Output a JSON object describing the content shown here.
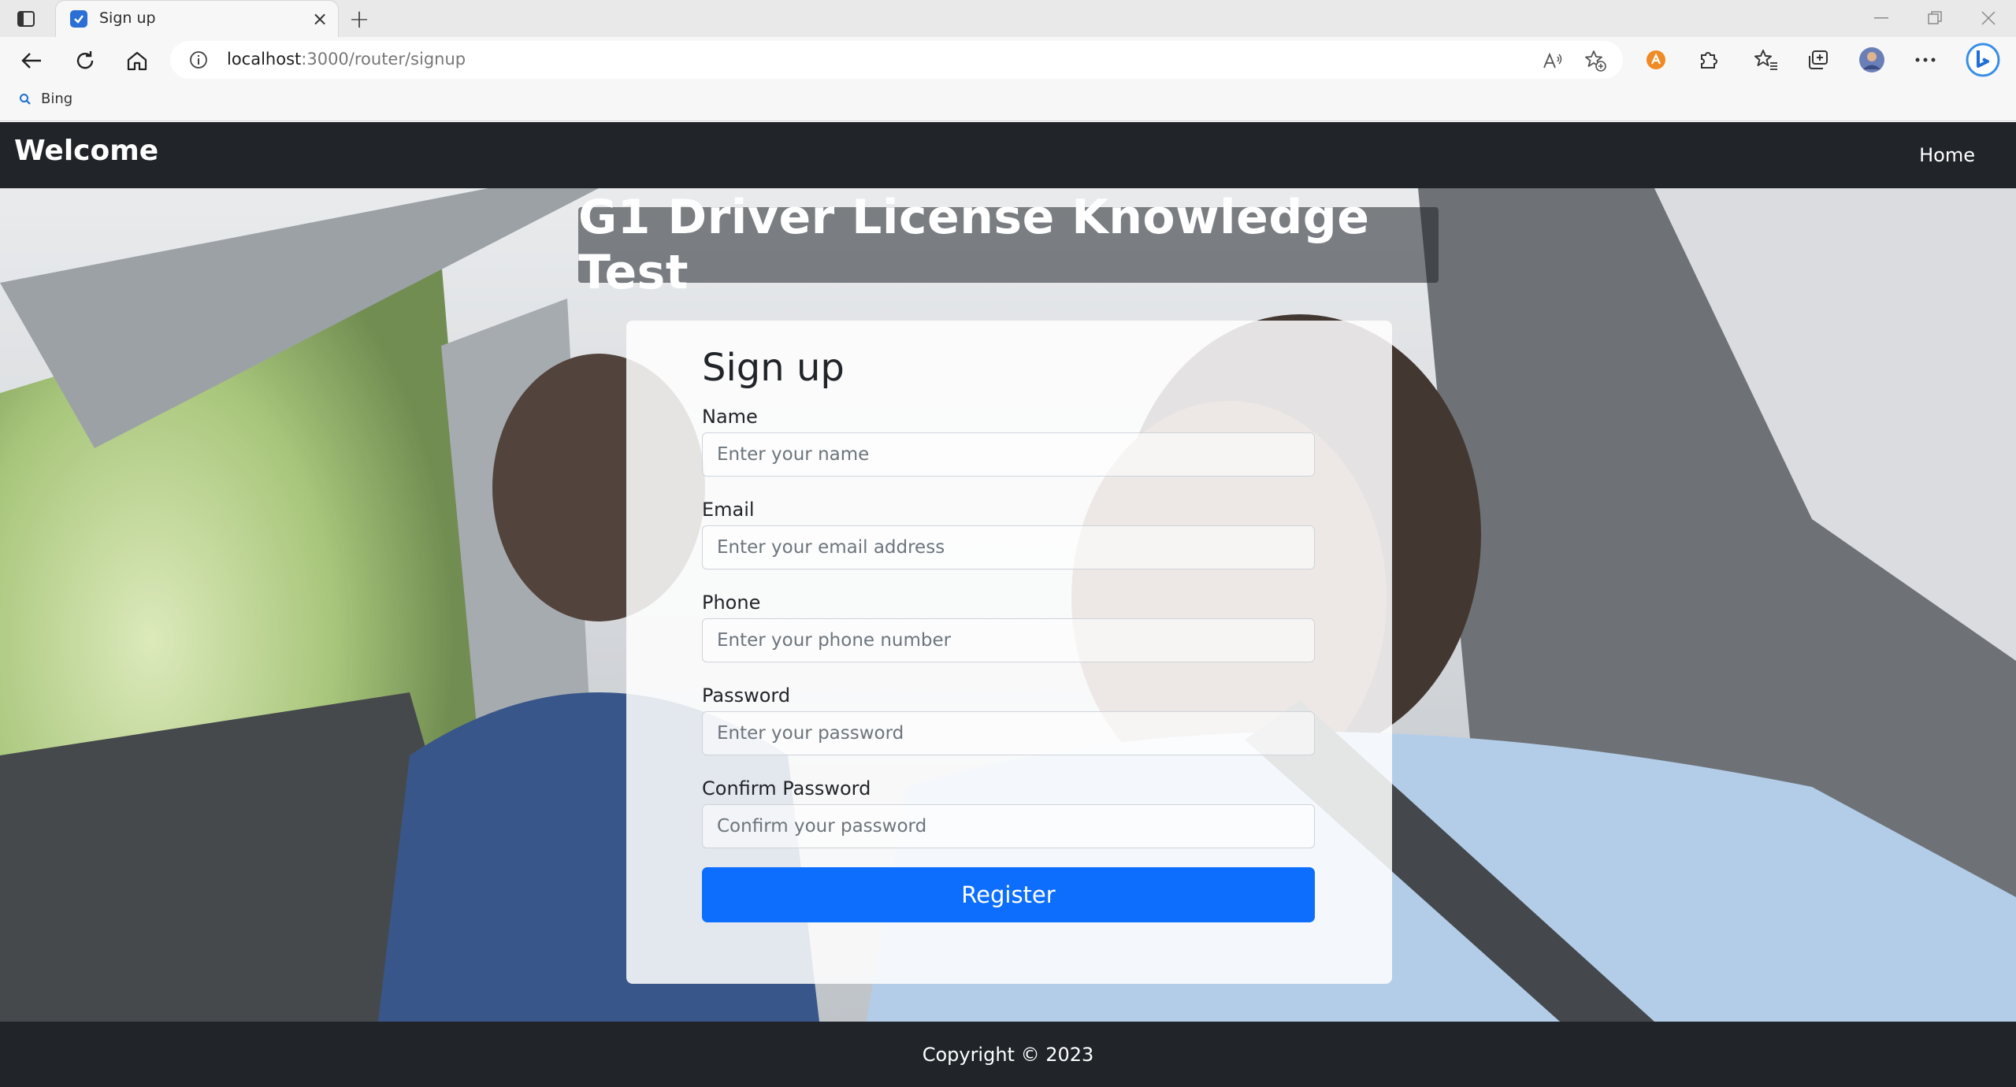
{
  "browser": {
    "tab": {
      "title": "Sign up"
    },
    "address": {
      "host": "localhost",
      "path": ":3000/router/signup"
    },
    "favorites": [
      {
        "label": "Bing"
      }
    ]
  },
  "page": {
    "navbar": {
      "brand": "Welcome",
      "links": [
        {
          "label": "Home"
        }
      ]
    },
    "headline": "G1 Driver License Knowledge Test",
    "form": {
      "title": "Sign up",
      "fields": [
        {
          "label": "Name",
          "placeholder": "Enter your name",
          "value": ""
        },
        {
          "label": "Email",
          "placeholder": "Enter your email address",
          "value": ""
        },
        {
          "label": "Phone",
          "placeholder": "Enter your phone number",
          "value": ""
        },
        {
          "label": "Password",
          "placeholder": "Enter your password",
          "value": ""
        },
        {
          "label": "Confirm Password",
          "placeholder": "Confirm your password",
          "value": ""
        }
      ],
      "submit_label": "Register"
    },
    "footer": {
      "text": "Copyright © 2023"
    }
  },
  "colors": {
    "navbar": "#212529",
    "primary_button": "#0d6efd",
    "card": "#ffffff",
    "browser_chrome": "#f7f7f7"
  },
  "icons": [
    "tab-actions-icon",
    "task-favicon",
    "close-icon",
    "plus-icon",
    "minimize-icon",
    "restore-icon",
    "back-arrow-icon",
    "refresh-icon",
    "home-icon",
    "info-icon",
    "read-aloud-icon",
    "add-favorite-icon",
    "extension-badge-icon",
    "puzzle-icon",
    "favorites-icon",
    "collections-icon",
    "profile-avatar",
    "more-icon",
    "bing-copilot-icon",
    "search-icon"
  ]
}
